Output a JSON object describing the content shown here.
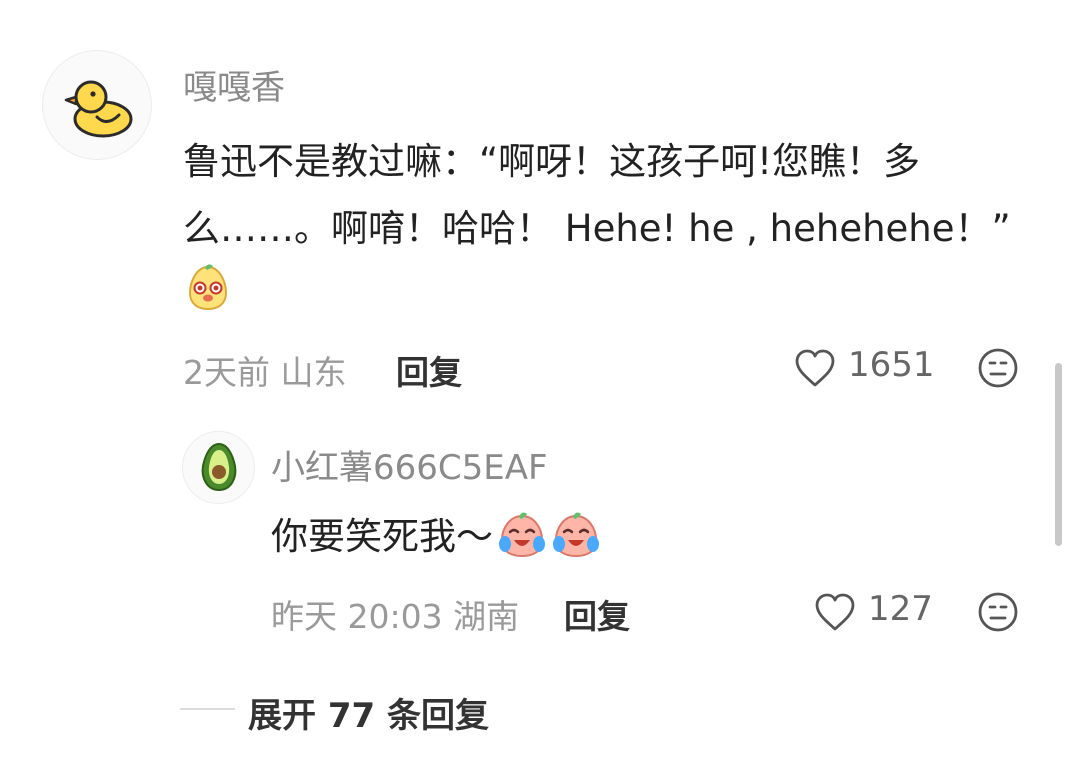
{
  "comment": {
    "username": "嘎嘎香",
    "text": "鲁迅不是教过嘛：“啊呀！这孩子呵!您瞧！多么……。啊唷！哈哈！ Hehe! he , hehehehe！”",
    "time": "2天前",
    "location": "山东",
    "reply_label": "回复",
    "likes": "1651",
    "avatar_icon": "duck-icon",
    "inline_emoji": "cute-face-emoji"
  },
  "reply": {
    "username": "小红薯666C5EAF",
    "text": "你要笑死我～",
    "time": "昨天 20:03",
    "location": "湖南",
    "reply_label": "回复",
    "likes": "127",
    "avatar_icon": "avocado-icon",
    "inline_emoji": "laugh-cry-emoji"
  },
  "expand": {
    "label": "展开 77 条回复"
  }
}
